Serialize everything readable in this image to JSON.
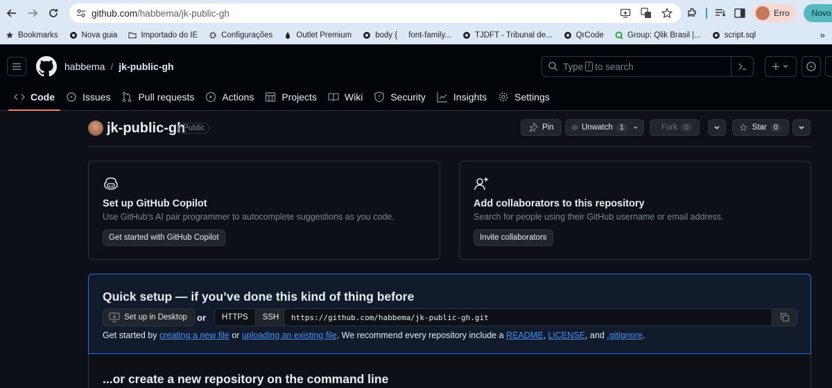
{
  "browser": {
    "url_host": "github.com",
    "url_path": "/habbema/jk-public-gh",
    "profile_label": "Erro",
    "novo_label": "Novo",
    "bookmarks": [
      {
        "label": "Bookmarks",
        "icon": "star-icon"
      },
      {
        "label": "Nova guia",
        "icon": "globe-icon"
      },
      {
        "label": "Importado do IE",
        "icon": "folder-icon"
      },
      {
        "label": "Configurações",
        "icon": "gear-icon"
      },
      {
        "label": "Outlet Premium",
        "icon": "drop-icon"
      },
      {
        "label": "body {",
        "icon": "globe-icon"
      },
      {
        "label": "font-family...",
        "icon": "none"
      },
      {
        "label": "TJDFT - Tribunal de...",
        "icon": "globe-icon"
      },
      {
        "label": "QrCode",
        "icon": "globe-icon"
      },
      {
        "label": "Group: Qlik Brasil |...",
        "icon": "qlik-icon"
      },
      {
        "label": "script.sql",
        "icon": "globe-icon"
      }
    ]
  },
  "header": {
    "owner": "habbema",
    "separator": "/",
    "repo": "jk-public-gh",
    "search_prefix": "Type",
    "search_key": "/",
    "search_suffix": "to search"
  },
  "tabs": [
    {
      "label": "Code",
      "icon": "code-icon",
      "active": true
    },
    {
      "label": "Issues",
      "icon": "issue-icon"
    },
    {
      "label": "Pull requests",
      "icon": "pull-request-icon"
    },
    {
      "label": "Actions",
      "icon": "play-icon"
    },
    {
      "label": "Projects",
      "icon": "table-icon"
    },
    {
      "label": "Wiki",
      "icon": "book-icon"
    },
    {
      "label": "Security",
      "icon": "shield-icon"
    },
    {
      "label": "Insights",
      "icon": "graph-icon"
    },
    {
      "label": "Settings",
      "icon": "gear-icon"
    }
  ],
  "repo": {
    "name": "jk-public-gh",
    "visibility": "Public",
    "pin_label": "Pin",
    "unwatch_label": "Unwatch",
    "watch_count": "1",
    "fork_label": "Fork",
    "fork_count": "0",
    "star_label": "Star",
    "star_count": "0"
  },
  "cards": {
    "copilot": {
      "title": "Set up GitHub Copilot",
      "desc": "Use GitHub's AI pair programmer to autocomplete suggestions as you code.",
      "button": "Get started with GitHub Copilot"
    },
    "collab": {
      "title": "Add collaborators to this repository",
      "desc": "Search for people using their GitHub username or email address.",
      "button": "Invite collaborators"
    }
  },
  "quick_setup": {
    "title": "Quick setup — if you’ve done this kind of thing before",
    "desktop_button": "Set up in Desktop",
    "or": "or",
    "https": "HTTPS",
    "ssh": "SSH",
    "clone_url": "https://github.com/habbema/jk-public-gh.git",
    "help_1": "Get started by ",
    "link_new_file": "creating a new file",
    "help_2": " or ",
    "link_upload": "uploading an existing file",
    "help_3": ". We recommend every repository include a ",
    "link_readme": "README",
    "help_4": ", ",
    "link_license": "LICENSE",
    "help_5": ", and ",
    "link_gitignore": ".gitignore",
    "help_6": "."
  },
  "cmdline": {
    "title": "...or create a new repository on the command line"
  }
}
